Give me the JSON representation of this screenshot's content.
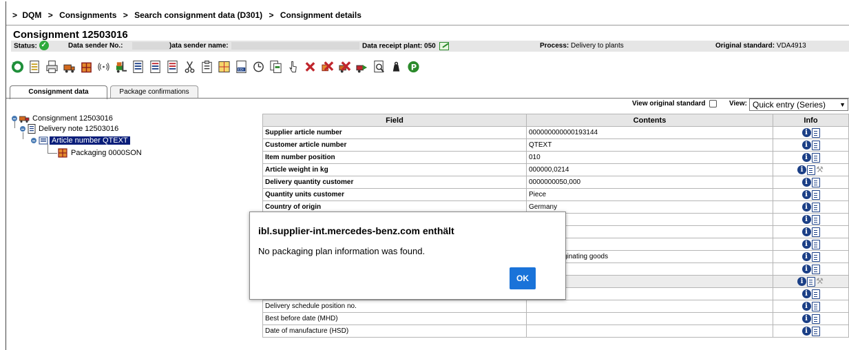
{
  "breadcrumb": {
    "prefix": ">",
    "items": [
      "DQM",
      "Consignments",
      "Search consignment data (D301)",
      "Consignment details"
    ]
  },
  "page_title": "Consignment 12503016",
  "status_bar": {
    "status_label": "Status:",
    "data_sender_no_label": "Data sender No.:",
    "data_sender_name_label": ")ata sender name:",
    "data_receipt_plant_label": "Data receipt plant: 050",
    "process_label": "Process:",
    "process_value": "Delivery to plants",
    "original_standard_label": "Original standard:",
    "original_standard_value": "VDA4913"
  },
  "toolbar_icons": [
    "refresh-icon",
    "document-icon",
    "print-icon",
    "truck-icon",
    "package-icon",
    "rfid-icon",
    "forklift-icon",
    "document-list-icon",
    "document-red-icon",
    "document-red-2-icon",
    "scissors-icon",
    "clipboard-icon",
    "table-icon",
    "edi-icon",
    "history-icon",
    "copy-icon",
    "pointer-icon",
    "delete-icon",
    "delete-package-icon",
    "delete-truck-icon",
    "truck-arrow-icon",
    "magnifier-icon",
    "weight-icon",
    "p-icon"
  ],
  "tabs": [
    {
      "label": "Consignment data",
      "active": true
    },
    {
      "label": "Package confirmations",
      "active": false
    }
  ],
  "tree": {
    "consignment": "Consignment 12503016",
    "delivery_note": "Delivery note 12503016",
    "article": "Article number QTEXT",
    "packaging": "Packaging 0000SON"
  },
  "view_bar": {
    "view_original_label": "View original standard",
    "view_label": "View:",
    "view_selected": "Quick entry (Series)"
  },
  "table": {
    "headers": [
      "Field",
      "Contents",
      "Info"
    ],
    "rows": [
      {
        "field": "Supplier article number",
        "value": "000000000000193144",
        "bold": true,
        "gray": false,
        "wrench": false
      },
      {
        "field": "Customer article number",
        "value": "QTEXT",
        "bold": true,
        "gray": false,
        "wrench": false
      },
      {
        "field": "Item number position",
        "value": "010",
        "bold": true,
        "gray": false,
        "wrench": false
      },
      {
        "field": "Article weight in kg",
        "value": "000000,0214",
        "bold": true,
        "gray": false,
        "wrench": true
      },
      {
        "field": "Delivery quantity customer",
        "value": "0000000050,000",
        "bold": true,
        "gray": false,
        "wrench": false
      },
      {
        "field": "Quantity units customer",
        "value": "Piece",
        "bold": true,
        "gray": false,
        "wrench": false
      },
      {
        "field": "Country of origin",
        "value": "Germany",
        "bold": true,
        "gray": false,
        "wrench": false
      },
      {
        "field": "",
        "value": "",
        "bold": true,
        "gray": false,
        "wrench": false
      },
      {
        "field": "",
        "value": "y]",
        "bold": true,
        "gray": false,
        "wrench": false
      },
      {
        "field": "",
        "value": "ods",
        "bold": true,
        "gray": false,
        "wrench": false
      },
      {
        "field": "",
        "value": "ated, no originating goods",
        "bold": true,
        "gray": false,
        "wrench": false
      },
      {
        "field": "",
        "value": "",
        "bold": true,
        "gray": false,
        "wrench": false
      },
      {
        "field": "",
        "value": "",
        "bold": true,
        "gray": true,
        "wrench": true
      },
      {
        "field": "Customer order number",
        "value": "",
        "bold": false,
        "gray": false,
        "wrench": false
      },
      {
        "field": "Delivery schedule position no.",
        "value": "",
        "bold": false,
        "gray": false,
        "wrench": false
      },
      {
        "field": "Best before date (MHD)",
        "value": "",
        "bold": false,
        "gray": false,
        "wrench": false
      },
      {
        "field": "Date of manufacture (HSD)",
        "value": "",
        "bold": false,
        "gray": false,
        "wrench": false
      }
    ]
  },
  "dialog": {
    "title": "ibl.supplier-int.mercedes-benz.com enthält",
    "message": "No packaging plan information was found.",
    "ok_label": "OK"
  },
  "colors": {
    "selected_node": "#0a1e7a",
    "ok_button": "#1a73d9",
    "info_icon": "#1b3f86",
    "status_ok": "#2eaa3c"
  }
}
